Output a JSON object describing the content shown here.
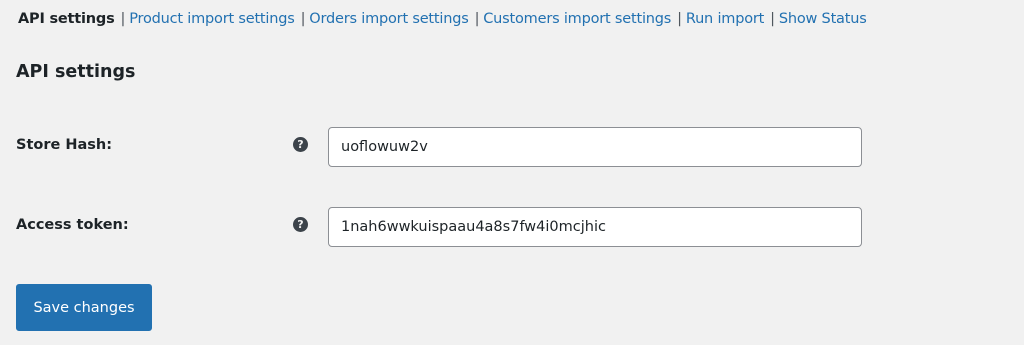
{
  "subnav": {
    "items": [
      {
        "label": "API settings",
        "current": true
      },
      {
        "label": "Product import settings",
        "current": false
      },
      {
        "label": "Orders import settings",
        "current": false
      },
      {
        "label": "Customers import settings",
        "current": false
      },
      {
        "label": "Run import",
        "current": false
      },
      {
        "label": "Show Status",
        "current": false
      }
    ],
    "separator": "|"
  },
  "section_title": "API settings",
  "fields": [
    {
      "label": "Store Hash:",
      "help_icon": "question-circle-icon",
      "help_glyph": "?",
      "value": "uoflowuw2v"
    },
    {
      "label": "Access token:",
      "help_icon": "question-circle-icon",
      "help_glyph": "?",
      "value": "1nah6wwkuispaau4a8s7fw4i0mcjhic"
    }
  ],
  "save_button": {
    "label": "Save changes"
  },
  "colors": {
    "background": "#f1f1f1",
    "link": "#2271b1",
    "primary_button": "#2271b1",
    "text": "#1d2327"
  }
}
